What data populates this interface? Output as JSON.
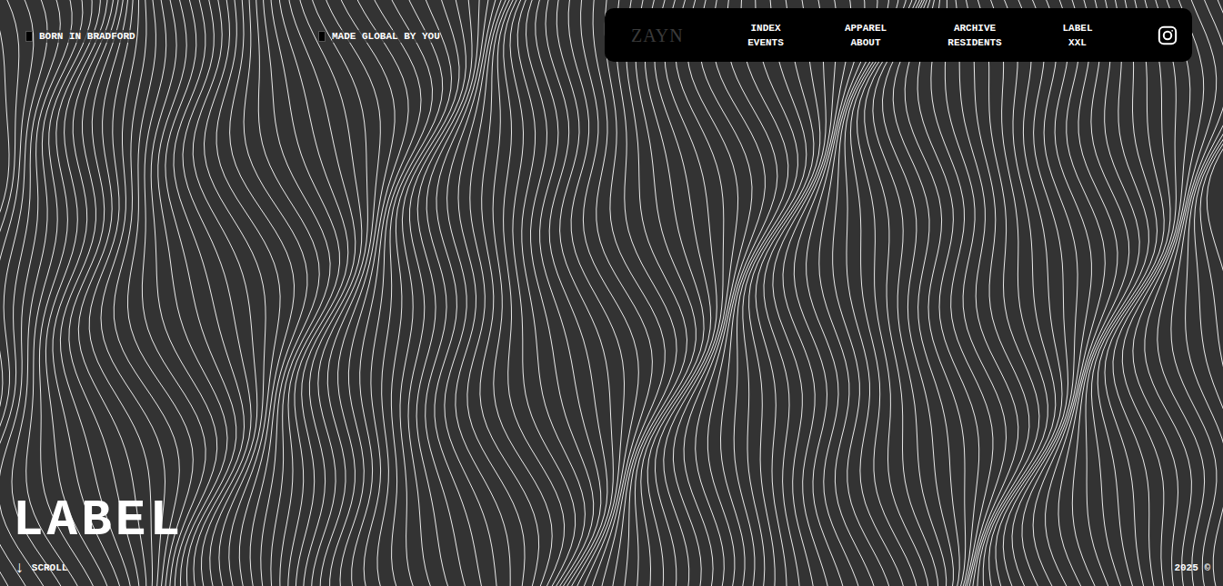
{
  "header": {
    "tags": [
      "BORN IN BRADFORD",
      "MADE GLOBAL BY YOU"
    ]
  },
  "nav": {
    "logo": "ZAYN",
    "columns": [
      {
        "top": "INDEX",
        "bottom": "EVENTS"
      },
      {
        "top": "APPAREL",
        "bottom": "ABOUT"
      },
      {
        "top": "ARCHIVE",
        "bottom": "RESIDENTS"
      },
      {
        "top": "LABEL",
        "bottom": "XXL"
      }
    ]
  },
  "hero": {
    "title": "LABEL"
  },
  "footer": {
    "scroll_arrow": "↓",
    "scroll_label": "SCROLL",
    "year": "2025 ©"
  }
}
